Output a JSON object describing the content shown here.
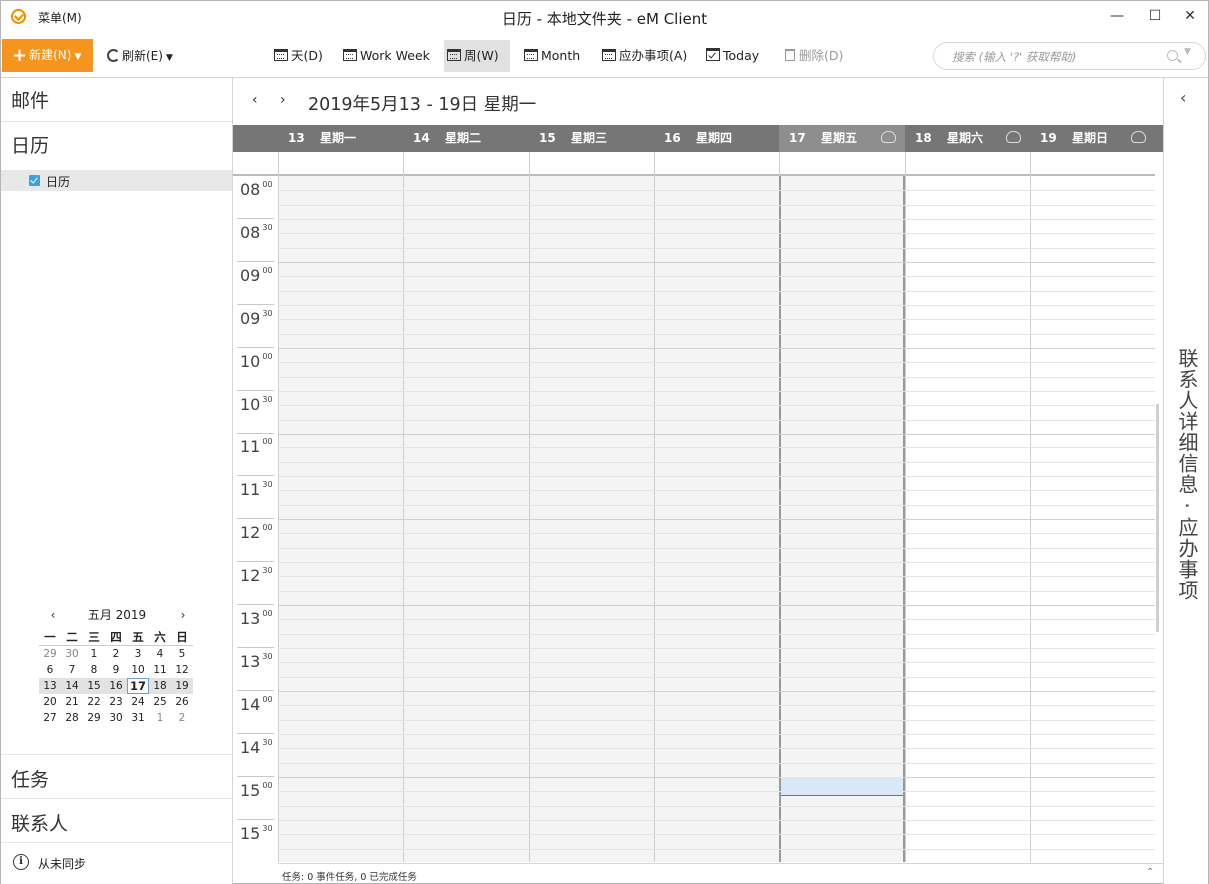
{
  "window": {
    "menu_label": "菜单(M)",
    "title": "日历 - 本地文件夹 - eM Client",
    "min_glyph": "—",
    "max_glyph": "☐",
    "close_glyph": "✕"
  },
  "toolbar": {
    "new_label": "新建(N)",
    "refresh_label": "刷新(E)",
    "views": [
      {
        "label": "天(D)",
        "icon": "calendar-day-icon"
      },
      {
        "label": "Work Week",
        "icon": "calendar-workweek-icon"
      },
      {
        "label": "周(W)",
        "icon": "calendar-week-icon",
        "active": true
      },
      {
        "label": "Month",
        "icon": "calendar-month-icon"
      },
      {
        "label": "应办事项(A)",
        "icon": "agenda-icon"
      },
      {
        "label": "Today",
        "icon": "today-check-icon"
      },
      {
        "label": "删除(D)",
        "icon": "trash-icon",
        "disabled": true
      }
    ],
    "search_placeholder": "搜索 (输入 '?' 获取帮助)"
  },
  "sidebar": {
    "mail": "邮件",
    "calendar": "日历",
    "calendar_items": [
      {
        "label": "日历",
        "checked": true
      }
    ],
    "tasks": "任务",
    "contacts": "联系人",
    "sync_status": "从未同步",
    "mini_calendar": {
      "title": "五月 2019",
      "dow": [
        "一",
        "二",
        "三",
        "四",
        "五",
        "六",
        "日"
      ],
      "weeks": [
        [
          "29",
          "30",
          "1",
          "2",
          "3",
          "4",
          "5"
        ],
        [
          "6",
          "7",
          "8",
          "9",
          "10",
          "11",
          "12"
        ],
        [
          "13",
          "14",
          "15",
          "16",
          "17",
          "18",
          "19"
        ],
        [
          "20",
          "21",
          "22",
          "23",
          "24",
          "25",
          "26"
        ],
        [
          "27",
          "28",
          "29",
          "30",
          "31",
          "1",
          "2"
        ]
      ],
      "today": "17"
    }
  },
  "main": {
    "range_title": "2019年5月13 - 19日 星期一",
    "days": [
      {
        "num": "13",
        "name": "星期一"
      },
      {
        "num": "14",
        "name": "星期二"
      },
      {
        "num": "15",
        "name": "星期三"
      },
      {
        "num": "16",
        "name": "星期四"
      },
      {
        "num": "17",
        "name": "星期五",
        "today": true,
        "weather": "rain-cloud-icon"
      },
      {
        "num": "18",
        "name": "星期六",
        "weather": "rain-cloud-icon"
      },
      {
        "num": "19",
        "name": "星期日",
        "weather": "partly-cloudy-icon"
      }
    ],
    "times": [
      {
        "h": "08",
        "m": "00"
      },
      {
        "h": "08",
        "m": "30"
      },
      {
        "h": "09",
        "m": "00"
      },
      {
        "h": "09",
        "m": "30"
      },
      {
        "h": "10",
        "m": "00"
      },
      {
        "h": "10",
        "m": "30"
      },
      {
        "h": "11",
        "m": "00"
      },
      {
        "h": "11",
        "m": "30"
      },
      {
        "h": "12",
        "m": "00"
      },
      {
        "h": "12",
        "m": "30"
      },
      {
        "h": "13",
        "m": "00"
      },
      {
        "h": "13",
        "m": "30"
      },
      {
        "h": "14",
        "m": "00"
      },
      {
        "h": "14",
        "m": "30"
      },
      {
        "h": "15",
        "m": "00"
      },
      {
        "h": "15",
        "m": "30"
      }
    ],
    "status_text": "任务: 0 事件任务, 0 已完成任务"
  },
  "right_panel": {
    "vertical_text": "联系人详细信息 · 应办事项"
  },
  "colors": {
    "accent": "#f7941d",
    "header_bg": "#767676",
    "selection": "#d8e8f7",
    "now_line": "#e04a3a"
  }
}
